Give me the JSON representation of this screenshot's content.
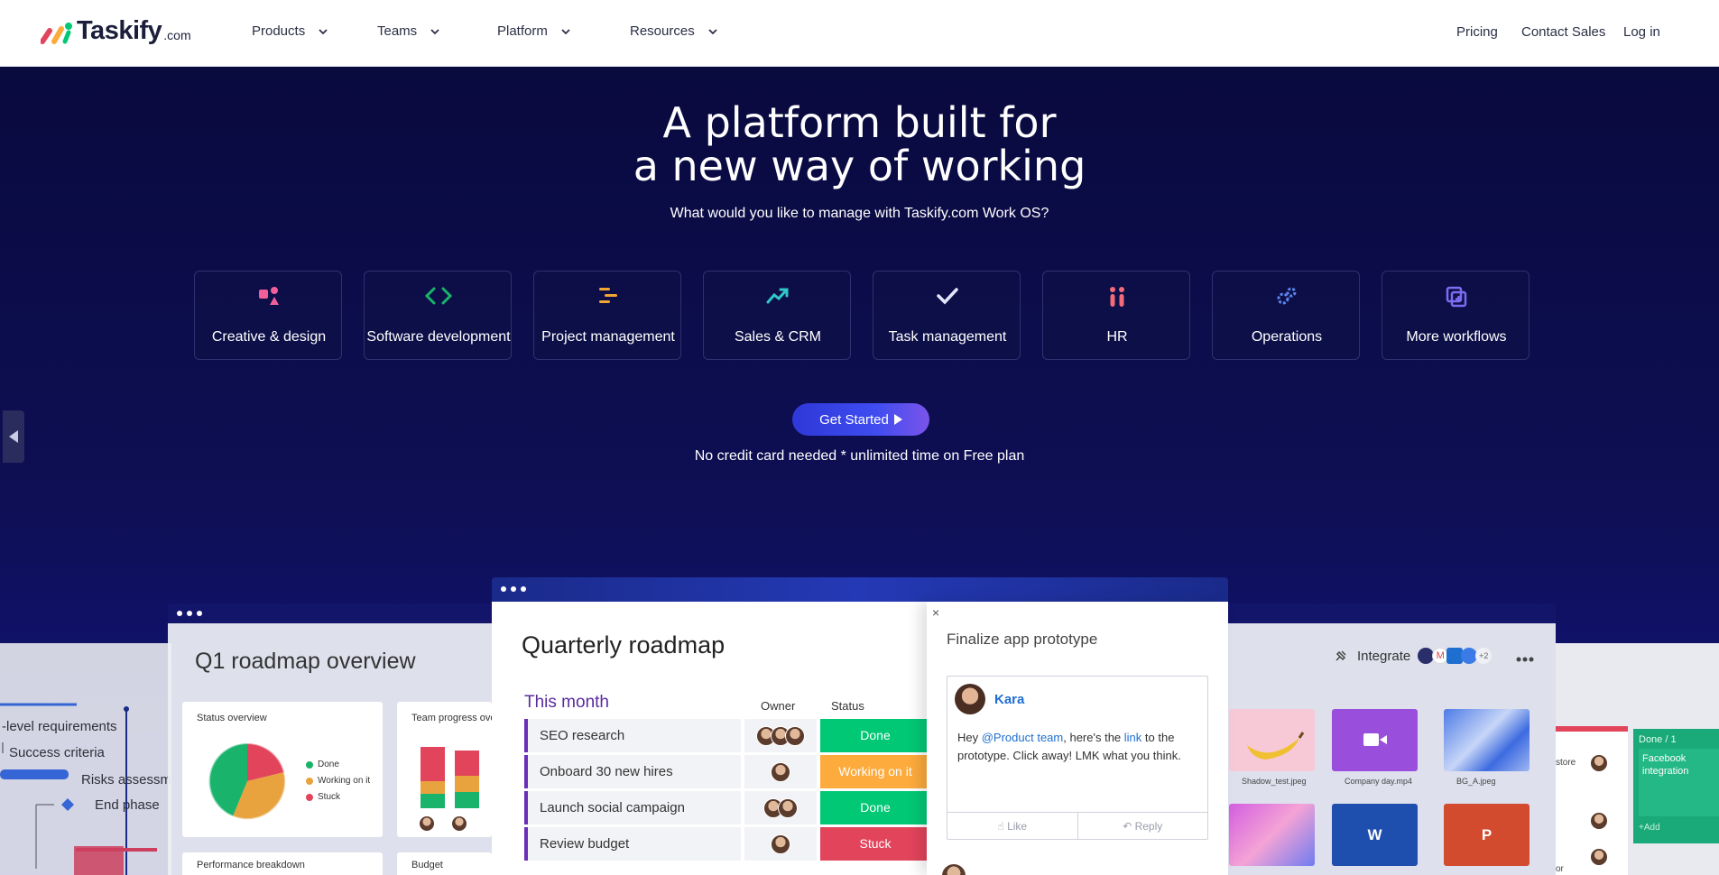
{
  "brand": {
    "word": "Taskify",
    "domain": ".com"
  },
  "nav": {
    "menu": [
      "Products",
      "Teams",
      "Platform",
      "Resources"
    ],
    "right": [
      "Pricing",
      "Contact Sales",
      "Log in"
    ]
  },
  "hero": {
    "headline_line1": "A platform built for",
    "headline_line2": "a new way of working",
    "subline": "What would you like to manage with Taskify.com Work OS?",
    "cards": [
      {
        "label": "Creative & design",
        "icon": "shapes-icon",
        "color": "#f15f9a"
      },
      {
        "label": "Software development",
        "icon": "code-icon",
        "color": "#19b36b"
      },
      {
        "label": "Project management",
        "icon": "gantt-icon",
        "color": "#f2a634"
      },
      {
        "label": "Sales & CRM",
        "icon": "trend-icon",
        "color": "#2ec8c8"
      },
      {
        "label": "Task management",
        "icon": "check-icon",
        "color": "#d9dcf7"
      },
      {
        "label": "HR",
        "icon": "people-icon",
        "color": "#f16b7a"
      },
      {
        "label": "Operations",
        "icon": "gears-icon",
        "color": "#5b86f0"
      },
      {
        "label": "More workflows",
        "icon": "layers-icon",
        "color": "#7d6bf2"
      }
    ],
    "cta": "Get Started",
    "note": "No credit card needed * unlimited time on Free plan"
  },
  "back_board": {
    "title": "Q1 roadmap overview",
    "panels": [
      "Status overview",
      "Team progress ove",
      "Performance breakdown",
      "Budget"
    ],
    "legend": [
      "Done",
      "Working on it",
      "Stuck"
    ],
    "left_items": [
      "-level requirements",
      "Success criteria",
      "Risks assessm",
      "End phase"
    ],
    "integrate": "Integrate",
    "integrate_more": "+2",
    "files": [
      "Shadow_test.jpeg",
      "Company day.mp4",
      "BG_A.jpeg"
    ],
    "file_letters": [
      "W",
      "P"
    ],
    "right_col": {
      "header": "Done / 1",
      "card": "Facebook integration",
      "add": "+Add",
      "store": "store",
      "or": "or"
    }
  },
  "front": {
    "title": "Quarterly roadmap",
    "group": "This month",
    "col_owner": "Owner",
    "col_status": "Status",
    "rows": [
      {
        "name": "SEO research",
        "status": "Done",
        "color": "#00c875"
      },
      {
        "name": "Onboard 30 new hires",
        "status": "Working on it",
        "color": "#fdab3d"
      },
      {
        "name": "Launch social campaign",
        "status": "Done",
        "color": "#00c875"
      },
      {
        "name": "Review budget",
        "status": "Stuck",
        "color": "#e2445c"
      }
    ],
    "panel": {
      "close": "×",
      "title": "Finalize app prototype",
      "author": "Kara",
      "msg_a": "Hey ",
      "mention": "@Product team",
      "msg_b": ", here's the ",
      "link": "link",
      "msg_c": " to the prototype. Click away! LMK what you think.",
      "like": "Like",
      "reply": "Reply"
    }
  }
}
